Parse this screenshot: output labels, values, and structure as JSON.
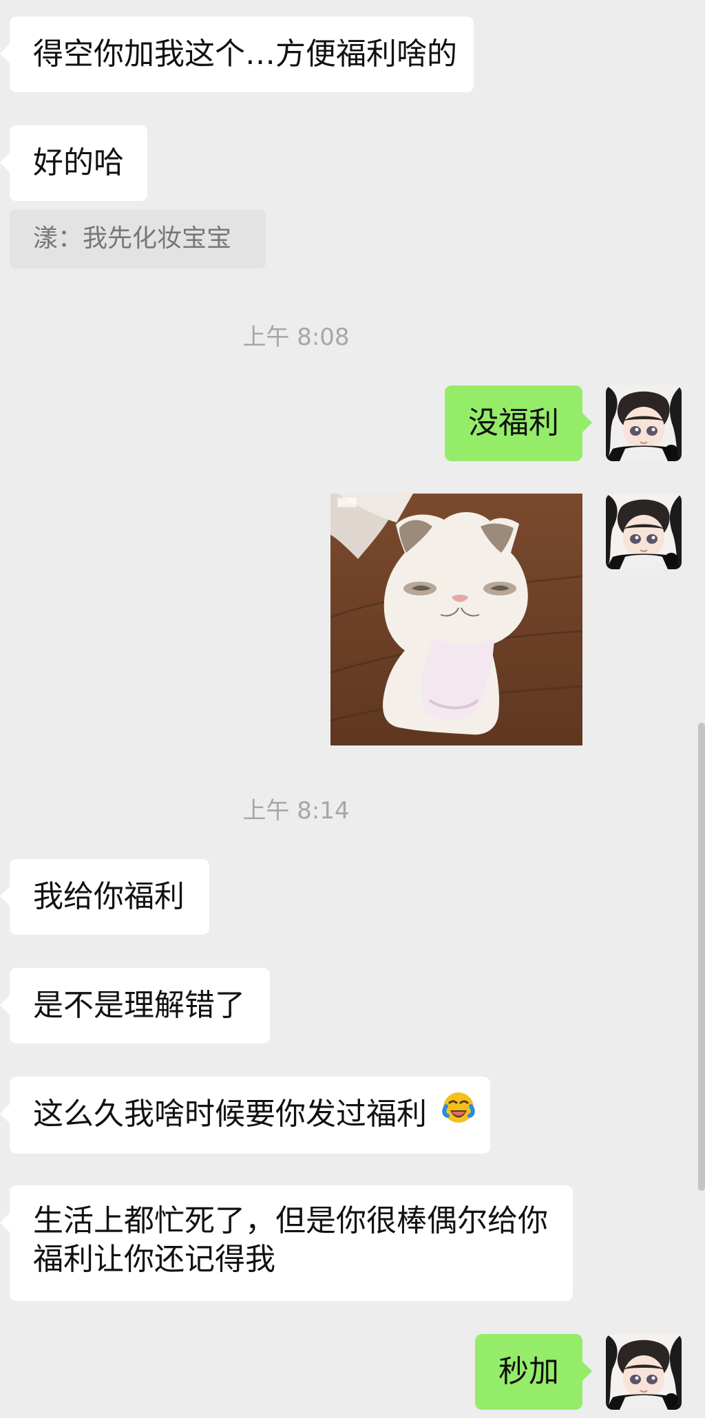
{
  "messages": {
    "m1": {
      "text": "得空你加我这个…方便福利啥的"
    },
    "m2": {
      "text": "好的哈"
    },
    "m2_quote": {
      "text": "漾：我先化妆宝宝"
    },
    "time1": {
      "text": "上午 8:08"
    },
    "m3": {
      "text": "没福利"
    },
    "m4_image": {
      "watermark": "DHH"
    },
    "time2": {
      "text": "上午 8:14"
    },
    "m5": {
      "text": "我给你福利"
    },
    "m6": {
      "text": "是不是理解错了"
    },
    "m7": {
      "text": "这么久我啥时候要你发过福利",
      "emoji": "laughing-crying-emoji"
    },
    "m8": {
      "text": "生活上都忙死了，但是你很棒偶尔给你福利让你还记得我"
    },
    "m9": {
      "text": "秒加"
    }
  },
  "colors": {
    "chat_background": "#ededed",
    "incoming_bubble": "#ffffff",
    "outgoing_bubble": "#95ec69",
    "timestamp": "#a6a6a6"
  }
}
